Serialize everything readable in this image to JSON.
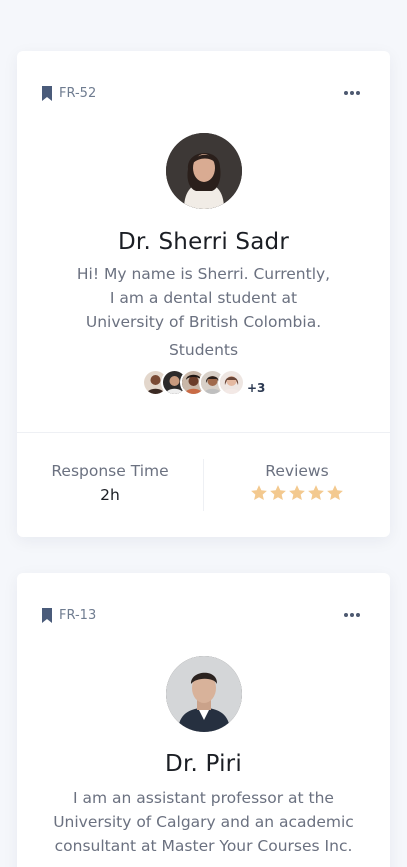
{
  "tutors": [
    {
      "tag": "FR-52",
      "name": "Dr. Sherri Sadr",
      "bio_lines": [
        "Hi! My name is Sherri. Currently,",
        "I am a dental student at",
        "University of British Colombia."
      ],
      "students_label": "Students",
      "students_more": "+3",
      "response_time_label": "Response Time",
      "response_time_value": "2h",
      "reviews_label": "Reviews",
      "rating": 5
    },
    {
      "tag": "FR-13",
      "name": "Dr. Piri",
      "bio_lines": [
        "I am an assistant professor at the",
        "University of Calgary and an academic",
        "consultant at Master Your Courses Inc."
      ]
    }
  ],
  "colors": {
    "star": "#f3c98f",
    "tag_text": "#6f7c90",
    "bookmark": "#4a5b7a",
    "background": "#f5f7fb"
  },
  "icons": {
    "tag": "bookmark-icon",
    "menu": "more-horizontal-icon",
    "rating": "star-icon"
  }
}
